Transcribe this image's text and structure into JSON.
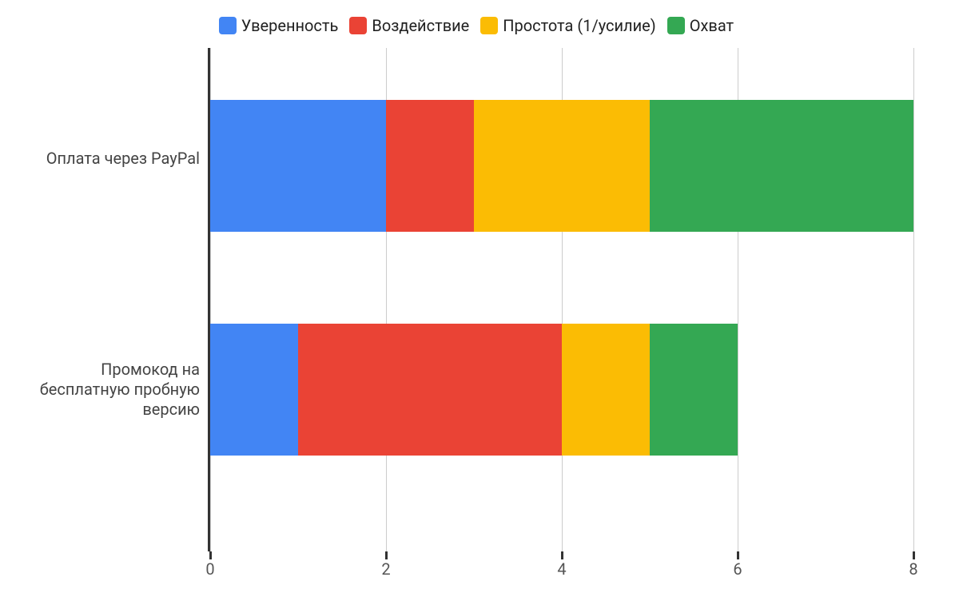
{
  "chart_data": {
    "type": "bar",
    "orientation": "horizontal",
    "stacked": true,
    "xlim": [
      0,
      8
    ],
    "xticks": [
      0,
      2,
      4,
      6,
      8
    ],
    "title": "",
    "xlabel": "",
    "ylabel": "",
    "categories": [
      "Оплата через PayPal",
      "Промокод на бесплатную пробную версию"
    ],
    "series": [
      {
        "name": "Уверенность",
        "color": "#4285F4",
        "values": [
          2,
          1
        ]
      },
      {
        "name": "Воздействие",
        "color": "#EA4335",
        "values": [
          1,
          3
        ]
      },
      {
        "name": "Простота (1/усилие)",
        "color": "#FBBC04",
        "values": [
          2,
          1
        ]
      },
      {
        "name": "Охват",
        "color": "#34A853",
        "values": [
          3,
          1
        ]
      }
    ],
    "legend_position": "top"
  }
}
